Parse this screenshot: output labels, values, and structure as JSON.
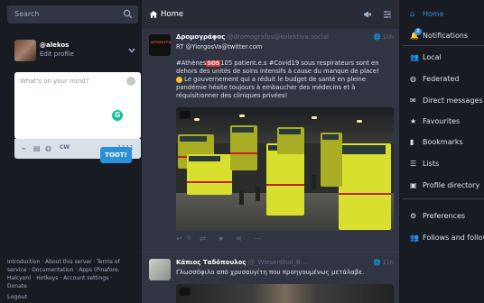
{
  "search": {
    "placeholder": "Search"
  },
  "profile": {
    "username": "@alekos",
    "edit_label": "Edit profile"
  },
  "composer": {
    "placeholder": "What's on your mind?",
    "cw_label": "CW",
    "char_count": "1111",
    "toot_label": "TOOT!"
  },
  "footer": {
    "links": "Introduction · About this server · Terms of service · Documentation · Apps (Pinafore, Halcyon) · Hotkeys · Account settings · Donate",
    "logout": "Logout"
  },
  "column": {
    "title": "Home"
  },
  "status1": {
    "display_name": "Δρομογράφος",
    "account": "@dromografos@kolektiva.social",
    "time": "10h",
    "avatar_text": "ΔΡΟΜΟΓΡΑΦΟΣ",
    "rt_line": "RT @YiorgosVa@twitter.com",
    "line1a": "#Athènes",
    "sos": "SOS",
    "line1b": "105 patient.e.s #Covid19 sous respirateurs sont en dehors des unités de soins intensifs à cause du manque de place!",
    "line2": "Le gouvernement qui a réduit le budget de santé en pleine pandémie hésite toujours à embaucher des médecins et à réquisitionner des cliniques privées!",
    "reply_count": "0"
  },
  "status2": {
    "display_name": "Κάπιος Ταδόπουλος",
    "account": "@_Wiesenthal_B...",
    "time": "11h",
    "text": "Γλωσσόφιλο από χρυσαυγίτη που προηγουμένως μετάλαβε."
  },
  "nav": {
    "items": [
      {
        "label": "Home",
        "icon": "home-icon",
        "active": true
      },
      {
        "label": "Notifications",
        "icon": "bell-icon",
        "badge": "8"
      },
      {
        "label": "Local",
        "icon": "users-icon"
      },
      {
        "label": "Federated",
        "icon": "globe-icon"
      },
      {
        "label": "Direct messages",
        "icon": "envelope-icon"
      },
      {
        "label": "Favourites",
        "icon": "star-icon"
      },
      {
        "label": "Bookmarks",
        "icon": "bookmark-icon"
      },
      {
        "label": "Lists",
        "icon": "list-icon"
      },
      {
        "label": "Profile directory",
        "icon": "address-book-icon"
      },
      {
        "label": "Preferences",
        "icon": "gear-icon"
      },
      {
        "label": "Follows and followers",
        "icon": "users-icon"
      }
    ]
  },
  "colors": {
    "accent": "#2b90d9",
    "background": "#191b22",
    "column": "#313543"
  }
}
